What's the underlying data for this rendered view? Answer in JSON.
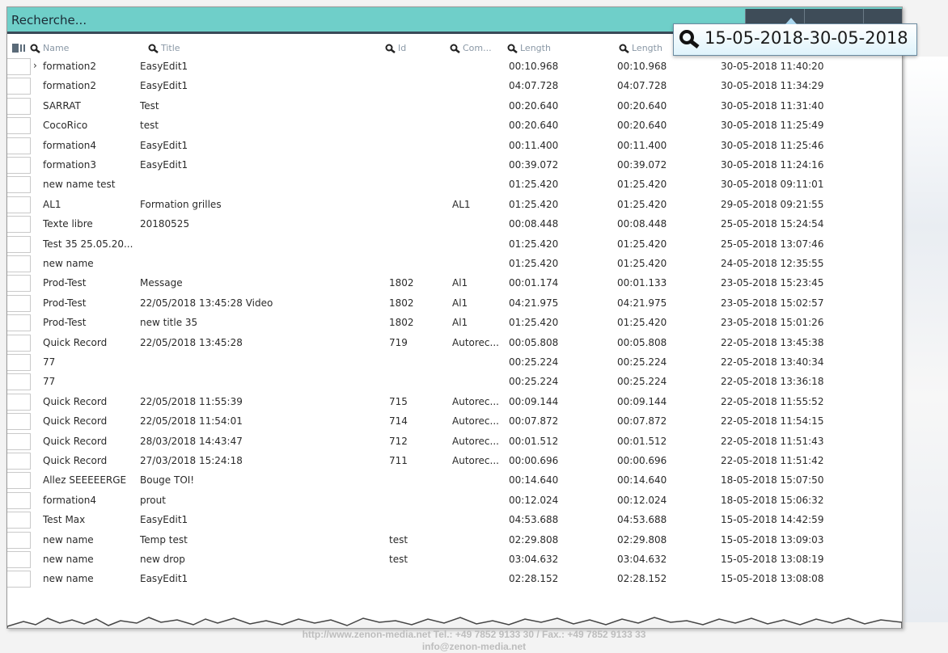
{
  "search": {
    "placeholder": "Recherche..."
  },
  "filter": {
    "date_value": "15-05-2018-30-05-2018"
  },
  "columns": {
    "name": "Name",
    "title": "Title",
    "id": "Id",
    "com": "Com...",
    "length": "Length",
    "length2": "Length"
  },
  "rows": [
    {
      "name": "formation2",
      "title": "EasyEdit1",
      "id": "",
      "com": "",
      "length": "00:10.968",
      "length2": "00:10.968",
      "date": "30-05-2018 11:40:20"
    },
    {
      "name": "formation2",
      "title": "EasyEdit1",
      "id": "",
      "com": "",
      "length": "04:07.728",
      "length2": "04:07.728",
      "date": "30-05-2018 11:34:29"
    },
    {
      "name": "SARRAT",
      "title": "Test",
      "id": "",
      "com": "",
      "length": "00:20.640",
      "length2": "00:20.640",
      "date": "30-05-2018 11:31:40"
    },
    {
      "name": "CocoRico",
      "title": "test",
      "id": "",
      "com": "",
      "length": "00:20.640",
      "length2": "00:20.640",
      "date": "30-05-2018 11:25:49"
    },
    {
      "name": "formation4",
      "title": "EasyEdit1",
      "id": "",
      "com": "",
      "length": "00:11.400",
      "length2": "00:11.400",
      "date": "30-05-2018 11:25:46"
    },
    {
      "name": "formation3",
      "title": "EasyEdit1",
      "id": "",
      "com": "",
      "length": "00:39.072",
      "length2": "00:39.072",
      "date": "30-05-2018 11:24:16"
    },
    {
      "name": "new name test",
      "title": "",
      "id": "",
      "com": "",
      "length": "01:25.420",
      "length2": "01:25.420",
      "date": "30-05-2018 09:11:01"
    },
    {
      "name": "AL1",
      "title": "Formation grilles",
      "id": "",
      "com": "AL1",
      "length": "01:25.420",
      "length2": "01:25.420",
      "date": "29-05-2018 09:21:55"
    },
    {
      "name": "Texte libre",
      "title": "20180525",
      "id": "",
      "com": "",
      "length": "00:08.448",
      "length2": "00:08.448",
      "date": "25-05-2018 15:24:54"
    },
    {
      "name": "Test 35 25.05.20...",
      "title": "",
      "id": "",
      "com": "",
      "length": "01:25.420",
      "length2": "01:25.420",
      "date": "25-05-2018 13:07:46"
    },
    {
      "name": "new name",
      "title": "",
      "id": "",
      "com": "",
      "length": "01:25.420",
      "length2": "01:25.420",
      "date": "24-05-2018 12:35:55"
    },
    {
      "name": "Prod-Test",
      "title": "Message",
      "id": "1802",
      "com": "Al1",
      "length": "00:01.174",
      "length2": "00:01.133",
      "date": "23-05-2018 15:23:45"
    },
    {
      "name": "Prod-Test",
      "title": "22/05/2018 13:45:28 Video",
      "id": "1802",
      "com": "Al1",
      "length": "04:21.975",
      "length2": "04:21.975",
      "date": "23-05-2018 15:02:57"
    },
    {
      "name": "Prod-Test",
      "title": "new title 35",
      "id": "1802",
      "com": "Al1",
      "length": "01:25.420",
      "length2": "01:25.420",
      "date": "23-05-2018 15:01:26"
    },
    {
      "name": "Quick Record",
      "title": "22/05/2018 13:45:28",
      "id": "719",
      "com": "Autorec...",
      "length": "00:05.808",
      "length2": "00:05.808",
      "date": "22-05-2018 13:45:38"
    },
    {
      "name": "77",
      "title": "",
      "id": "",
      "com": "",
      "length": "00:25.224",
      "length2": "00:25.224",
      "date": "22-05-2018 13:40:34"
    },
    {
      "name": "77",
      "title": "",
      "id": "",
      "com": "",
      "length": "00:25.224",
      "length2": "00:25.224",
      "date": "22-05-2018 13:36:18"
    },
    {
      "name": "Quick Record",
      "title": "22/05/2018 11:55:39",
      "id": "715",
      "com": "Autorec...",
      "length": "00:09.144",
      "length2": "00:09.144",
      "date": "22-05-2018 11:55:52"
    },
    {
      "name": "Quick Record",
      "title": "22/05/2018 11:54:01",
      "id": "714",
      "com": "Autorec...",
      "length": "00:07.872",
      "length2": "00:07.872",
      "date": "22-05-2018 11:54:15"
    },
    {
      "name": "Quick Record",
      "title": "28/03/2018 14:43:47",
      "id": "712",
      "com": "Autorec...",
      "length": "00:01.512",
      "length2": "00:01.512",
      "date": "22-05-2018 11:51:43"
    },
    {
      "name": "Quick Record",
      "title": "27/03/2018 15:24:18",
      "id": "711",
      "com": "Autorec...",
      "length": "00:00.696",
      "length2": "00:00.696",
      "date": "22-05-2018 11:51:42"
    },
    {
      "name": "Allez SEEEEERGE",
      "title": "Bouge TOI!",
      "id": "",
      "com": "",
      "length": "00:14.640",
      "length2": "00:14.640",
      "date": "18-05-2018 15:07:50"
    },
    {
      "name": "formation4",
      "title": "prout",
      "id": "",
      "com": "",
      "length": "00:12.024",
      "length2": "00:12.024",
      "date": "18-05-2018 15:06:32"
    },
    {
      "name": "Test Max",
      "title": "EasyEdit1",
      "id": "",
      "com": "",
      "length": "04:53.688",
      "length2": "04:53.688",
      "date": "15-05-2018 14:42:59"
    },
    {
      "name": "new name",
      "title": "Temp test",
      "id": "test",
      "com": "",
      "length": "02:29.808",
      "length2": "02:29.808",
      "date": "15-05-2018 13:09:03"
    },
    {
      "name": "new name",
      "title": "new drop",
      "id": "test",
      "com": "",
      "length": "03:04.632",
      "length2": "03:04.632",
      "date": "15-05-2018 13:08:19"
    },
    {
      "name": "new name",
      "title": "EasyEdit1",
      "id": "",
      "com": "",
      "length": "02:28.152",
      "length2": "02:28.152",
      "date": "15-05-2018 13:08:08"
    }
  ],
  "footer": {
    "line1": "http://www.zenon-media.net Tel.: +49 7852 9133 30 / Fax.: +49 7852 9133 33",
    "line2": "info@zenon-media.net"
  },
  "icons": {
    "search": "magnifier-icon",
    "columns": "column-chooser-icon",
    "expand": "chevron-right-icon"
  }
}
